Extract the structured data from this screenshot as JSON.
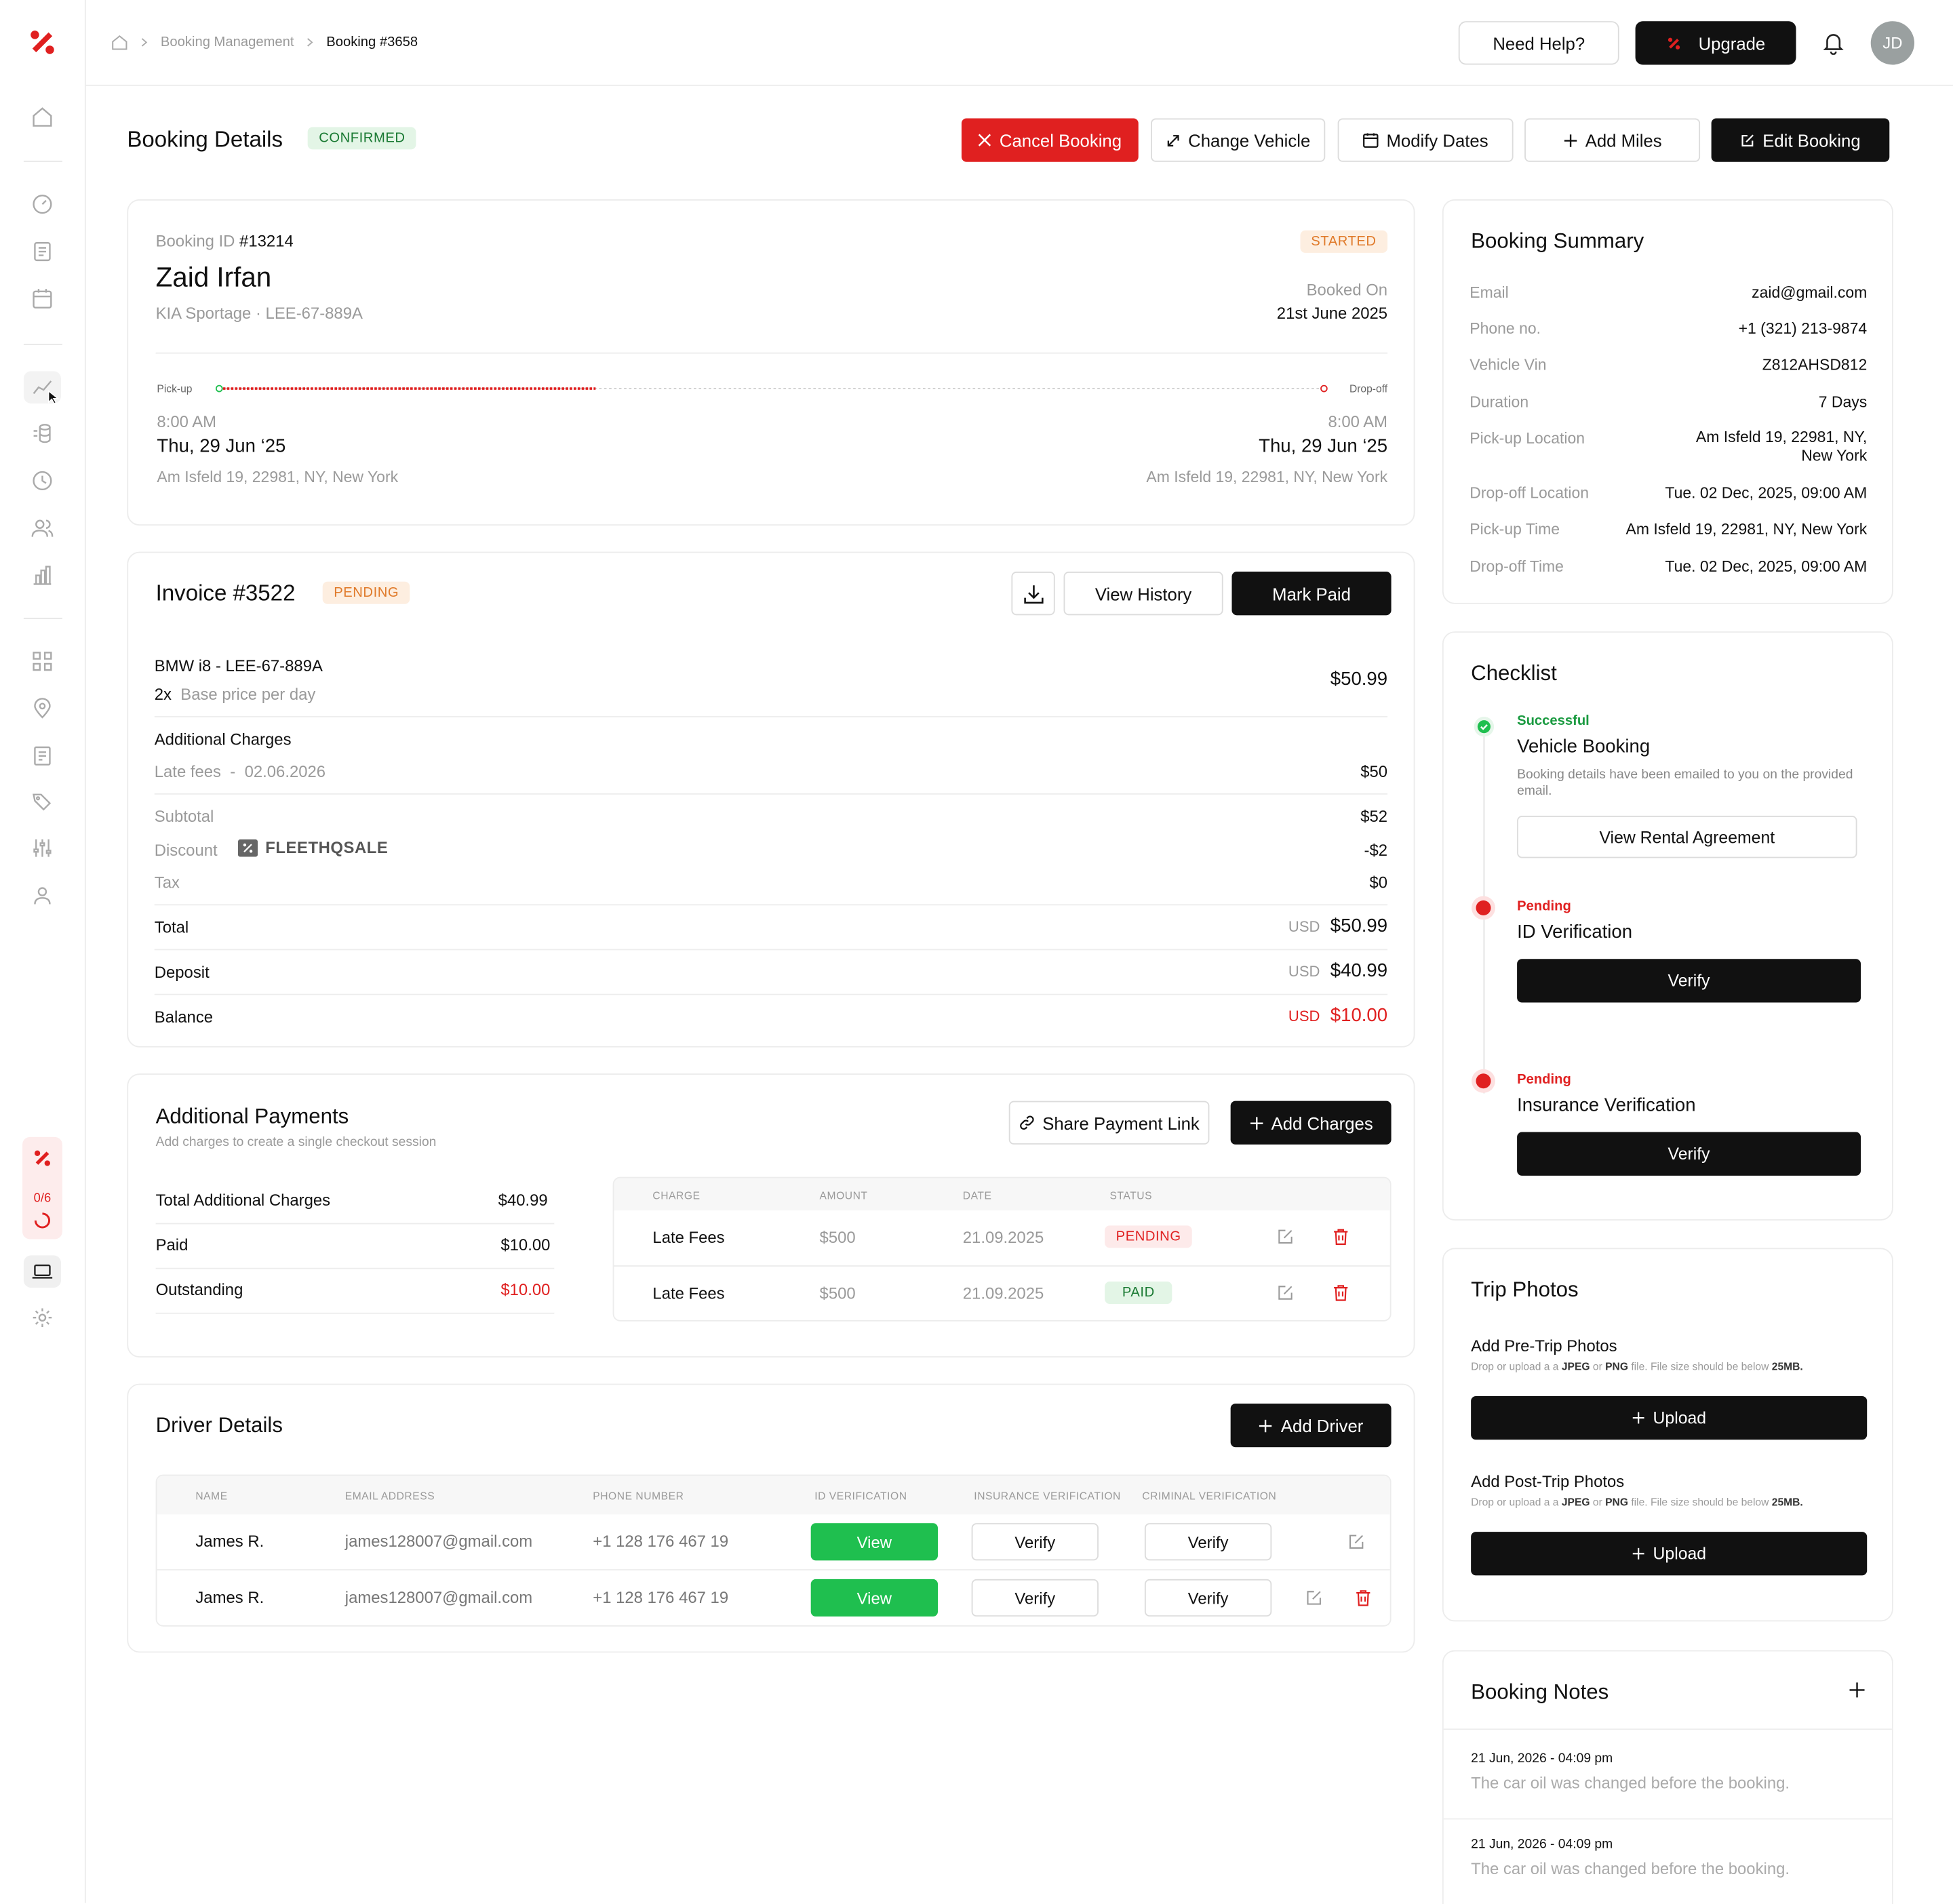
{
  "sidebar": {
    "progress": "0/6"
  },
  "breadcrumb": {
    "parent": "Booking Management",
    "current": "Booking #3658"
  },
  "header": {
    "help": "Need Help?",
    "upgrade": "Upgrade",
    "avatar": "JD"
  },
  "page": {
    "title": "Booking Details",
    "status": "CONFIRMED"
  },
  "actions": {
    "cancel": "Cancel Booking",
    "change_vehicle": "Change Vehicle",
    "modify_dates": "Modify Dates",
    "add_miles": "Add Miles",
    "edit": "Edit Booking"
  },
  "booking": {
    "id_label": "Booking ID",
    "id": "#13214",
    "trip_status": "STARTED",
    "customer": "Zaid Irfan",
    "vehicle": "KIA Sportage",
    "plate": "LEE-67-889A",
    "booked_on_label": "Booked On",
    "booked_on": "21st June 2025",
    "progress": 0.34,
    "pickup": {
      "label": "Pick-up",
      "time": "8:00 AM",
      "date": "Thu, 29 Jun ‘25",
      "address": "Am Isfeld 19, 22981, NY, New York"
    },
    "dropoff": {
      "label": "Drop-off",
      "time": "8:00 AM",
      "date": "Thu, 29 Jun ‘25",
      "address": "Am Isfeld 19, 22981, NY, New York"
    }
  },
  "invoice": {
    "title": "Invoice #3522",
    "status": "PENDING",
    "view_history": "View History",
    "mark_paid": "Mark Paid",
    "item": "BMW i8 - LEE-67-889A",
    "qty": "2x",
    "qty_label": "Base price per day",
    "item_price": "$50.99",
    "additional_label": "Additional Charges",
    "late_label": "Late fees",
    "late_sep": "-",
    "late_date": "02.06.2026",
    "late_amount": "$50",
    "subtotal_label": "Subtotal",
    "subtotal": "$52",
    "discount_label": "Discount",
    "discount_code": "FLEETHQSALE",
    "discount": "-$2",
    "tax_label": "Tax",
    "tax": "$0",
    "total_label": "Total",
    "currency": "USD",
    "total": "$50.99",
    "deposit_label": "Deposit",
    "deposit": "$40.99",
    "balance_label": "Balance",
    "balance": "$10.00"
  },
  "payments": {
    "title": "Additional Payments",
    "subtitle": "Add charges to create a single checkout session",
    "share": "Share Payment Link",
    "add": "Add Charges",
    "summary": [
      {
        "label": "Total Additional Charges",
        "value": "$40.99"
      },
      {
        "label": "Paid",
        "value": "$10.00"
      },
      {
        "label": "Outstanding",
        "value": "$10.00"
      }
    ],
    "headers": [
      "CHARGE",
      "AMOUNT",
      "DATE",
      "STATUS"
    ],
    "rows": [
      {
        "charge": "Late Fees",
        "amount": "$500",
        "date": "21.09.2025",
        "status": "PENDING"
      },
      {
        "charge": "Late Fees",
        "amount": "$500",
        "date": "21.09.2025",
        "status": "PAID"
      }
    ]
  },
  "drivers": {
    "title": "Driver Details",
    "add": "Add Driver",
    "headers": [
      "NAME",
      "EMAIL ADDRESS",
      "PHONE NUMBER",
      "ID VERIFICATION",
      "INSURANCE VERIFICATION",
      "CRIMINAL VERIFICATION"
    ],
    "rows": [
      {
        "name": "James R.",
        "email": "james128007@gmail.com",
        "phone": "+1 128 176 467 19",
        "id": "View",
        "insurance": "Verify",
        "criminal": "Verify"
      },
      {
        "name": "James R.",
        "email": "james128007@gmail.com",
        "phone": "+1 128 176 467 19",
        "id": "View",
        "insurance": "Verify",
        "criminal": "Verify"
      }
    ]
  },
  "summary": {
    "title": "Booking Summary",
    "rows": [
      {
        "label": "Email",
        "value": "zaid@gmail.com"
      },
      {
        "label": "Phone no.",
        "value": "+1 (321) 213-9874"
      },
      {
        "label": "Vehicle Vin",
        "value": "Z812AHSD812"
      },
      {
        "label": "Duration",
        "value": "7 Days"
      },
      {
        "label": "Pick-up Location",
        "value": "Am Isfeld 19, 22981, NY, New York"
      },
      {
        "label": "Drop-off Location",
        "value": "Tue. 02 Dec, 2025, 09:00 AM"
      },
      {
        "label": "Pick-up Time",
        "value": "Am Isfeld 19, 22981, NY, New York"
      },
      {
        "label": "Drop-off Time",
        "value": "Tue. 02 Dec, 2025, 09:00 AM"
      }
    ]
  },
  "checklist": {
    "title": "Checklist",
    "items": [
      {
        "status": "Successful",
        "title": "Vehicle Booking",
        "desc": "Booking details have been emailed to you on the provided email.",
        "action": "View Rental Agreement"
      },
      {
        "status": "Pending",
        "title": "ID Verification",
        "action": "Verify"
      },
      {
        "status": "Pending",
        "title": "Insurance Verification",
        "action": "Verify"
      }
    ]
  },
  "photos": {
    "title": "Trip Photos",
    "pre": "Add Pre-Trip Photos",
    "post": "Add Post-Trip Photos",
    "hint_a": "Drop or upload a a",
    "jpeg": "JPEG",
    "or": "or",
    "png": "PNG",
    "hint_b": "file. File size should be below",
    "max": "25MB.",
    "upload": "Upload"
  },
  "notes": {
    "title": "Booking Notes",
    "items": [
      {
        "date": "21 Jun, 2026 - 04:09 pm",
        "text": "The car oil was changed before the booking."
      },
      {
        "date": "21 Jun, 2026 - 04:09 pm",
        "text": "The car oil was changed before the booking."
      }
    ]
  },
  "colors": {
    "accent": "#e02020",
    "success": "#1fbf4f",
    "dark": "#111111"
  }
}
